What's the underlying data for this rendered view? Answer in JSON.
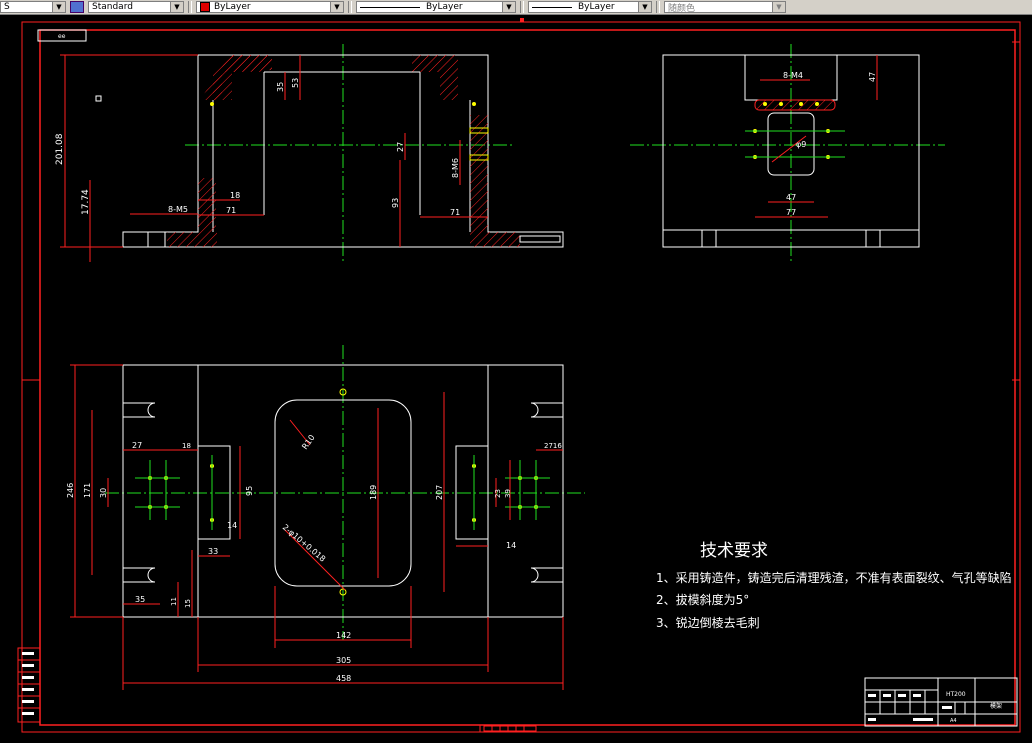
{
  "toolbar": {
    "textstyle_value": "S",
    "dimstyle_value": "Standard",
    "color_value": "ByLayer",
    "color_swatch": "#e00000",
    "linetype_value": "ByLayer",
    "lineweight_value": "ByLayer",
    "plotstyle_value": "随颜色"
  },
  "colors": {
    "background": "#000000",
    "border": "#ff2020",
    "geometry": "#ffffff",
    "centerline": "#20e020",
    "hatch": "#ff2020",
    "dimension": "#ff2020",
    "dim_text": "#ffffff",
    "point": "#ffff00"
  },
  "drawing": {
    "small_label": "ee",
    "dims_left_view": {
      "d_201_08": "201.08",
      "d_17_74": "17.74",
      "d_8m5": "8-M5",
      "d_71a": "71",
      "d_18": "18",
      "d_35": "35",
      "d_53": "53",
      "d_27": "27",
      "d_8m6": "8-M6",
      "d_93": "93",
      "d_71b": "71"
    },
    "dims_right_view": {
      "d_8m4": "8-M4",
      "d_47a": "47",
      "d_phi9": "φ9",
      "d_47b": "47",
      "d_77": "77"
    },
    "dims_plan_view": {
      "d_246": "246",
      "d_171": "171",
      "d_30": "30",
      "d_27": "27",
      "d_18": "18",
      "d_95": "95",
      "d_14a": "14",
      "d_33": "33",
      "d_35": "35",
      "d_11": "11",
      "d_15": "15",
      "d_r10": "R10",
      "d_189": "189",
      "d_207": "207",
      "d_hole": "2-φ10+0.018",
      "d_2716": "2716",
      "d_23": "23",
      "d_39": "39",
      "d_14b": "14",
      "d_142": "142",
      "d_305": "305",
      "d_458": "458"
    }
  },
  "notes": {
    "title": "技术要求",
    "line1": "1、采用铸造件，铸造完后清理残渣，不准有表面裂纹、气孔等缺陷",
    "line2": "2、拔模斜度为5°",
    "line3": "3、锐边倒棱去毛刺"
  },
  "titleblock": {
    "part_name": "模架",
    "material": "HT200",
    "scale": "A4"
  }
}
